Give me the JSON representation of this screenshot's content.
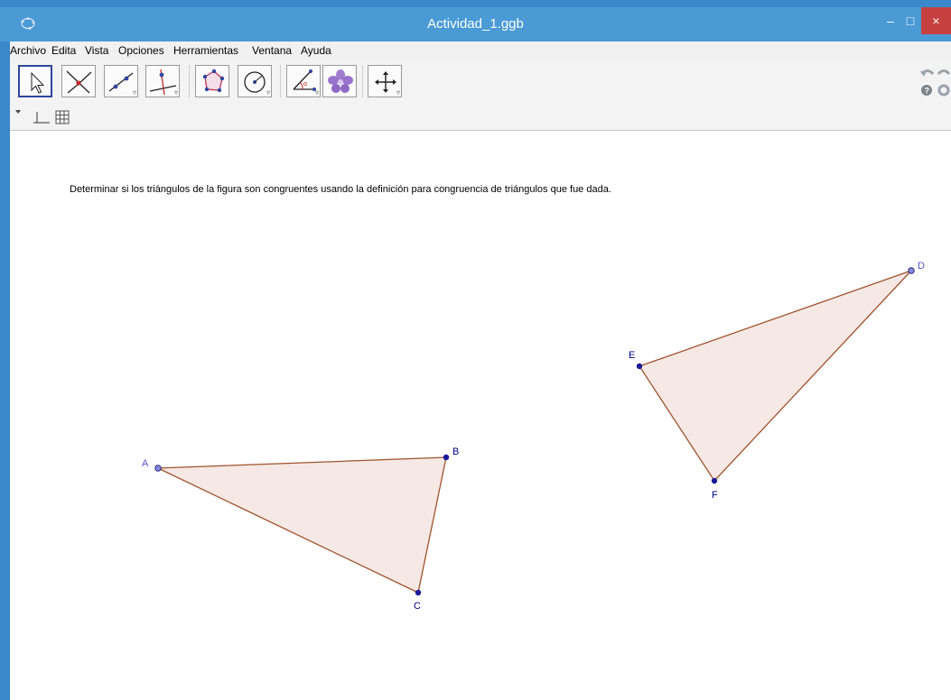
{
  "window": {
    "title": "Actividad_1.ggb",
    "min_glyph": "–",
    "max_glyph": "□",
    "close_glyph": "×"
  },
  "menu": {
    "items": [
      "Archivo",
      "Edita",
      "Vista",
      "Opciones",
      "Herramientas",
      "Ventana",
      "Ayuda"
    ]
  },
  "toolbar": {
    "tools": [
      {
        "name": "move-tool",
        "icon": "pointer-arrow-icon",
        "active": true
      },
      {
        "name": "point-tool",
        "icon": "intersect-point-icon"
      },
      {
        "name": "line-tool",
        "icon": "line-through-points-icon"
      },
      {
        "name": "perpendicular-tool",
        "icon": "perpendicular-line-icon"
      },
      {
        "name": "polygon-tool",
        "icon": "polygon-icon"
      },
      {
        "name": "circle-tool",
        "icon": "circle-icon"
      },
      {
        "name": "angle-tool",
        "icon": "angle-icon"
      },
      {
        "name": "reflect-tool",
        "icon": "reflect-flower-icon"
      },
      {
        "name": "move-view-tool",
        "icon": "move-graphics-view-icon"
      }
    ]
  },
  "canvas": {
    "instruction": "Determinar si los triángulos de la figura son congruentes usando la definición para congruencia de triángulos que fue dada.",
    "points": {
      "A": "A",
      "B": "B",
      "C": "C",
      "D": "D",
      "E": "E",
      "F": "F"
    }
  },
  "colors": {
    "titlebar": "#4a9ad6",
    "triangle_fill": "#f3e2dc",
    "triangle_stroke": "#a0522d",
    "point_fill": "#1a1a99",
    "free_point_fill": "#6666cc",
    "label_free": "#5555cc",
    "label_dep": "#000080"
  }
}
